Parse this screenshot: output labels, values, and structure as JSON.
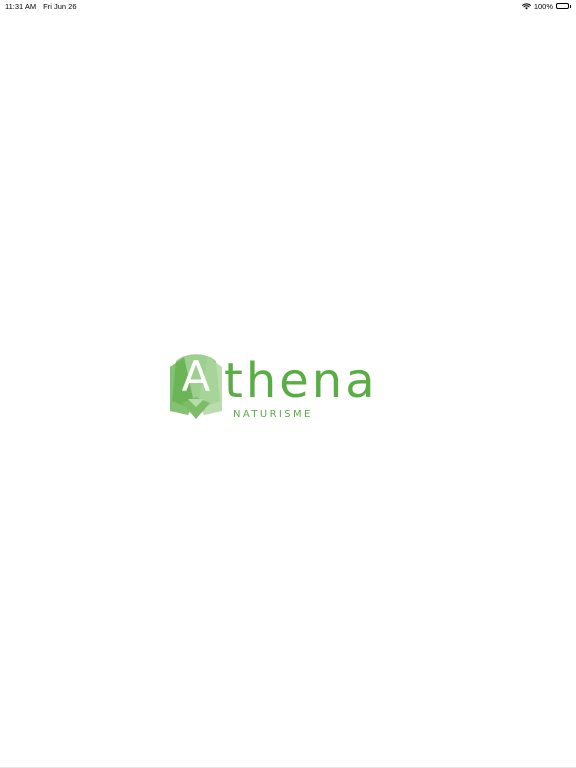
{
  "status_bar": {
    "time": "11:31 AM",
    "date": "Fri Jun 26",
    "battery_percent": "100%",
    "battery_level": 1.0,
    "wifi_icon": "wifi-icon",
    "battery_icon": "battery-icon"
  },
  "logo": {
    "letter": "A",
    "word": "thena",
    "subtitle": "NATURISME",
    "brand_color": "#5aac44"
  }
}
